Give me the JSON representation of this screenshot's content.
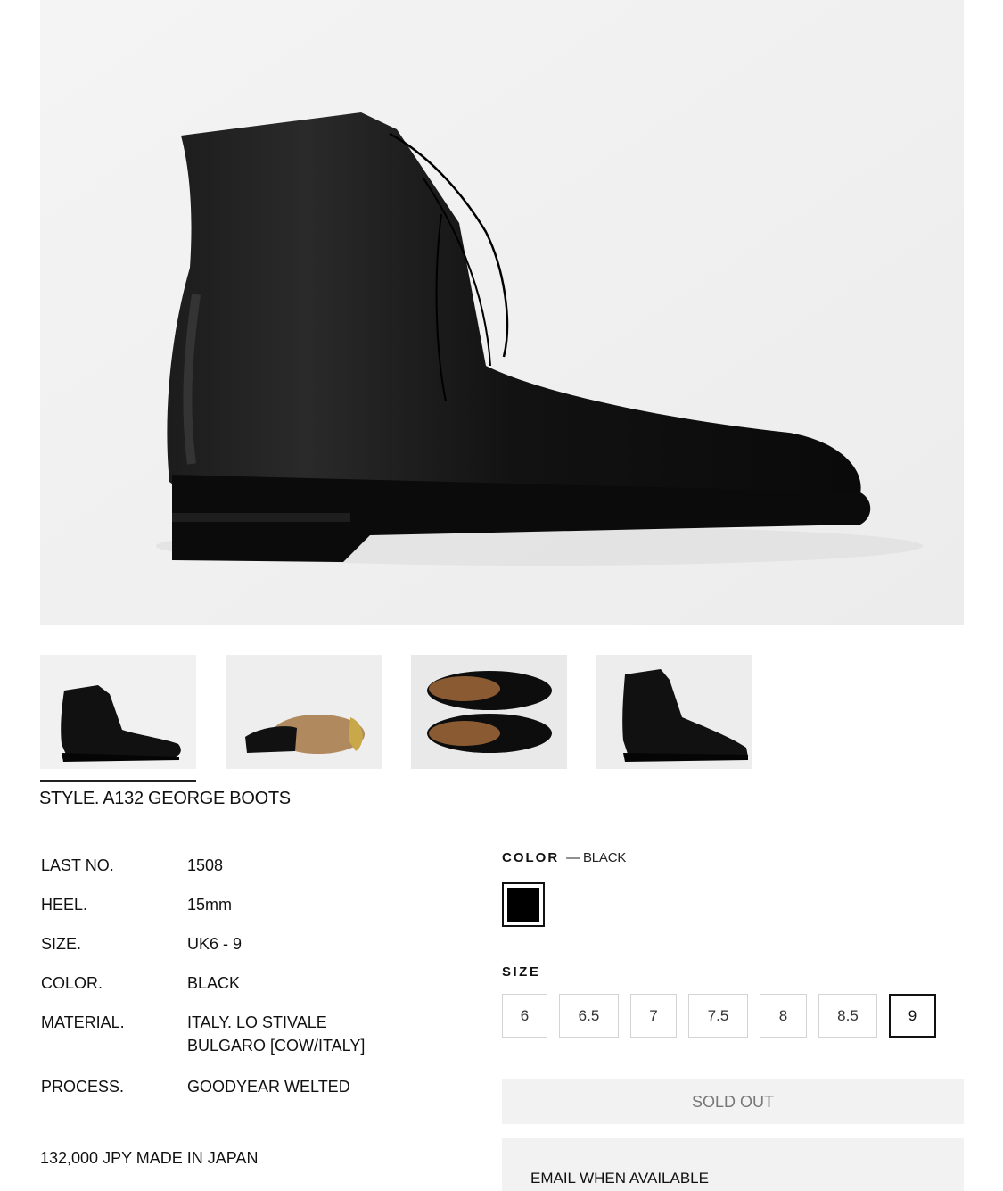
{
  "gallery": {
    "main_image": "black-chukka-boot-side-view",
    "thumbnails": [
      {
        "image": "boot-side-view",
        "active": true
      },
      {
        "image": "boot-sole-view",
        "active": false
      },
      {
        "image": "boots-top-view-pair",
        "active": false
      },
      {
        "image": "boot-angle-view",
        "active": false
      }
    ]
  },
  "product": {
    "title": "STYLE. A132 GEORGE BOOTS",
    "specs": [
      {
        "key": "LAST NO.",
        "value": "1508"
      },
      {
        "key": "HEEL.",
        "value": "15mm"
      },
      {
        "key": "SIZE.",
        "value": "UK6 - 9"
      },
      {
        "key": "COLOR.",
        "value": "BLACK"
      },
      {
        "key": "MATERIAL.",
        "value": "ITALY. LO STIVALE\nBULGARO [COW/ITALY]"
      },
      {
        "key": "PROCESS.",
        "value": "GOODYEAR WELTED"
      }
    ],
    "price_line": "132,000 JPY MADE IN JAPAN"
  },
  "options": {
    "color_label": "COLOR",
    "color_selected": "— BLACK",
    "swatch_color": "#000000",
    "size_label": "SIZE",
    "sizes": [
      "6",
      "6.5",
      "7",
      "7.5",
      "8",
      "8.5",
      "9"
    ],
    "selected_size": "9"
  },
  "actions": {
    "sold_out_label": "SOLD OUT",
    "email_label": "EMAIL WHEN AVAILABLE"
  }
}
